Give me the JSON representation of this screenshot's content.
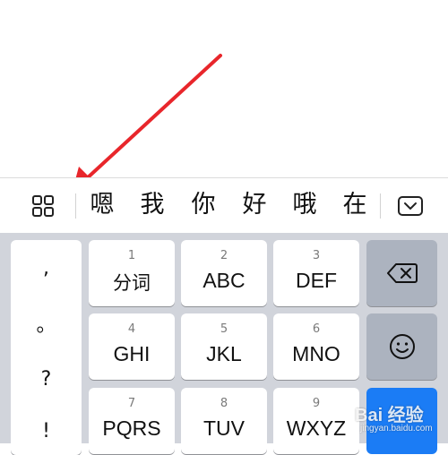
{
  "colors": {
    "keyboard_bg": "#d1d4db",
    "key_bg": "#ffffff",
    "function_key_bg": "#acb3bf",
    "accent_key": "#1b7cf5",
    "annotation_arrow": "#e8262b"
  },
  "candidate_bar": {
    "grid_icon": "grid-icon",
    "candidates": [
      "嗯",
      "我",
      "你",
      "好",
      "哦",
      "在"
    ],
    "collapse_icon": "chevron-down-icon"
  },
  "punctuation": [
    ",",
    "。",
    "?",
    "!"
  ],
  "keys": [
    {
      "num": "1",
      "label": "分词"
    },
    {
      "num": "2",
      "label": "ABC"
    },
    {
      "num": "3",
      "label": "DEF"
    },
    {
      "num": "4",
      "label": "GHI"
    },
    {
      "num": "5",
      "label": "JKL"
    },
    {
      "num": "6",
      "label": "MNO"
    },
    {
      "num": "7",
      "label": "PQRS"
    },
    {
      "num": "8",
      "label": "TUV"
    },
    {
      "num": "9",
      "label": "WXYZ"
    }
  ],
  "function_keys": {
    "delete_icon": "backspace-icon",
    "emoji_icon": "smiley-icon"
  },
  "watermark": {
    "text": "Bai 经验",
    "url": "jingyan.baidu.com"
  }
}
